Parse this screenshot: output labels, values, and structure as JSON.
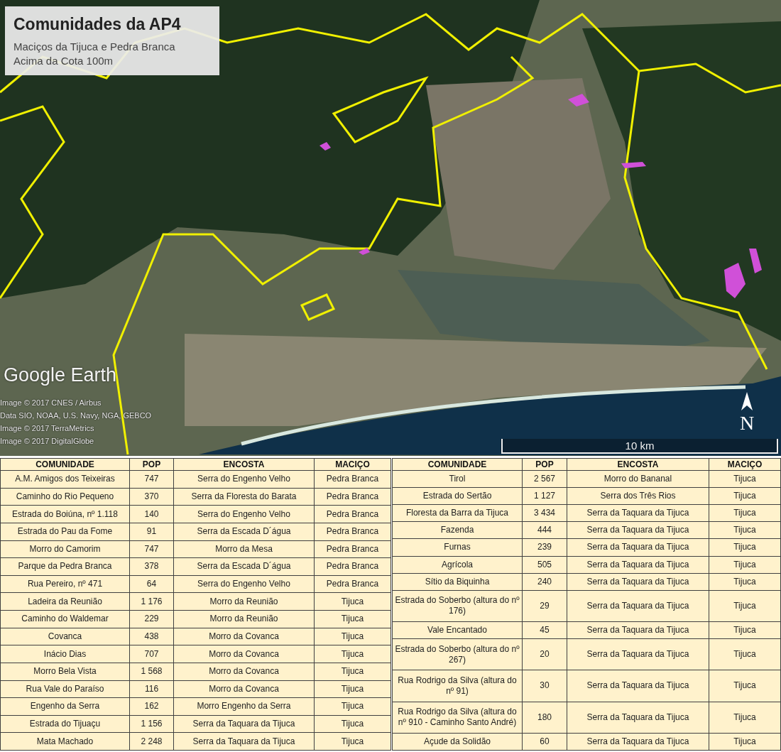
{
  "map": {
    "title": "Comunidades da AP4",
    "subtitle_lines": [
      "Maciços da Tijuca e Pedra Branca",
      "Acima da Cota 100m"
    ],
    "logo": "Google Earth",
    "credits": [
      "Image © 2017 CNES / Airbus",
      "Data SIO, NOAA, U.S. Navy, NGA, GEBCO",
      "Image © 2017 TerraMetrics",
      "Image © 2017 DigitalGlobe"
    ],
    "north_label": "N",
    "scale_label": "10 km"
  },
  "tables": [
    {
      "columns": [
        "COMUNIDADE",
        "POP",
        "ENCOSTA",
        "MACIÇO"
      ],
      "rows": [
        [
          "A.M. Amigos dos Teixeiras",
          "747",
          "Serra do Engenho Velho",
          "Pedra Branca"
        ],
        [
          "Caminho do Rio Pequeno",
          "370",
          "Serra da Floresta do Barata",
          "Pedra Branca"
        ],
        [
          "Estrada do Boiúna, nº 1.118",
          "140",
          "Serra do Engenho Velho",
          "Pedra Branca"
        ],
        [
          "Estrada do Pau da Fome",
          "91",
          "Serra da Escada D´água",
          "Pedra Branca"
        ],
        [
          "Morro do Camorim",
          "747",
          "Morro da Mesa",
          "Pedra Branca"
        ],
        [
          "Parque da Pedra Branca",
          "378",
          "Serra da Escada D´água",
          "Pedra Branca"
        ],
        [
          "Rua Pereiro, nº 471",
          "64",
          "Serra do Engenho Velho",
          "Pedra Branca"
        ],
        [
          "Ladeira da Reunião",
          "1 176",
          "Morro da Reunião",
          "Tijuca"
        ],
        [
          "Caminho do Waldemar",
          "229",
          "Morro da Reunião",
          "Tijuca"
        ],
        [
          "Covanca",
          "438",
          "Morro da Covanca",
          "Tijuca"
        ],
        [
          "Inácio Dias",
          "707",
          "Morro da Covanca",
          "Tijuca"
        ],
        [
          "Morro Bela Vista",
          "1 568",
          "Morro da Covanca",
          "Tijuca"
        ],
        [
          "Rua Vale do Paraíso",
          "116",
          "Morro da Covanca",
          "Tijuca"
        ],
        [
          "Engenho da Serra",
          "162",
          "Morro Engenho da Serra",
          "Tijuca"
        ],
        [
          "Estrada do Tijuaçu",
          "1 156",
          "Serra da Taquara da Tijuca",
          "Tijuca"
        ],
        [
          "Mata Machado",
          "2 248",
          "Serra da Taquara da Tijuca",
          "Tijuca"
        ]
      ]
    },
    {
      "columns": [
        "COMUNIDADE",
        "POP",
        "ENCOSTA",
        "MACIÇO"
      ],
      "rows": [
        [
          "Tirol",
          "2 567",
          "Morro do Bananal",
          "Tijuca"
        ],
        [
          "Estrada do Sertão",
          "1 127",
          "Serra dos Três Rios",
          "Tijuca"
        ],
        [
          "Floresta da Barra da Tijuca",
          "3 434",
          "Serra da Taquara da Tijuca",
          "Tijuca"
        ],
        [
          "Fazenda",
          "444",
          "Serra da Taquara da Tijuca",
          "Tijuca"
        ],
        [
          "Furnas",
          "239",
          "Serra da Taquara da Tijuca",
          "Tijuca"
        ],
        [
          "Agrícola",
          "505",
          "Serra da Taquara da Tijuca",
          "Tijuca"
        ],
        [
          "Sítio da Biquinha",
          "240",
          "Serra da Taquara da Tijuca",
          "Tijuca"
        ],
        [
          "Estrada do Soberbo (altura do nº 176)",
          "29",
          "Serra da Taquara da Tijuca",
          "Tijuca"
        ],
        [
          "Vale Encantado",
          "45",
          "Serra da Taquara da Tijuca",
          "Tijuca"
        ],
        [
          "Estrada do Soberbo (altura do nº 267)",
          "20",
          "Serra da Taquara da Tijuca",
          "Tijuca"
        ],
        [
          "Rua Rodrigo da Silva (altura do nº 91)",
          "30",
          "Serra da Taquara da Tijuca",
          "Tijuca"
        ],
        [
          "Rua Rodrigo da Silva (altura do nº 910 - Caminho Santo André)",
          "180",
          "Serra da Taquara da Tijuca",
          "Tijuca"
        ],
        [
          "Açude da Solidão",
          "60",
          "Serra da Taquara da Tijuca",
          "Tijuca"
        ]
      ]
    }
  ]
}
